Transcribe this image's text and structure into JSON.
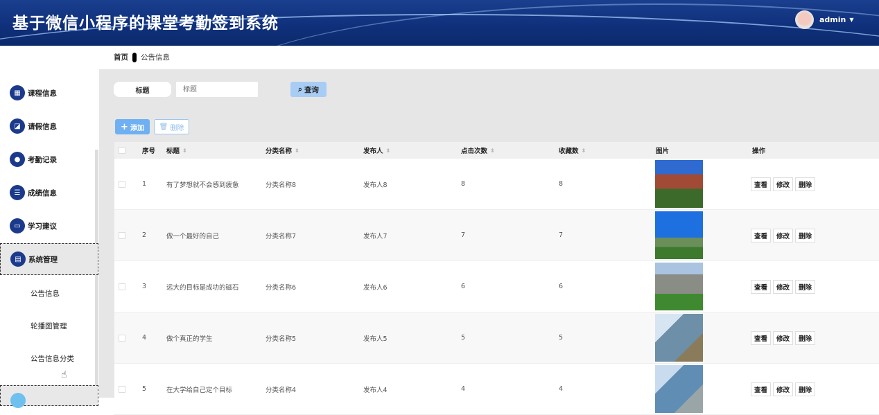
{
  "header": {
    "title": "基于微信小程序的课堂考勤签到系统",
    "user": "admin"
  },
  "sidebar": {
    "items": [
      {
        "label": "课程信息",
        "icon": "grid-icon",
        "glyph": "▦"
      },
      {
        "label": "请假信息",
        "icon": "chart-icon",
        "glyph": "◪"
      },
      {
        "label": "考勤记录",
        "icon": "user-icon",
        "glyph": "●"
      },
      {
        "label": "成绩信息",
        "icon": "sliders-icon",
        "glyph": "☰"
      },
      {
        "label": "学习建议",
        "icon": "chat-icon",
        "glyph": "▭"
      },
      {
        "label": "系统管理",
        "icon": "clipboard-icon",
        "glyph": "▤"
      }
    ],
    "subitems": [
      "公告信息",
      "轮播图管理",
      "公告信息分类"
    ]
  },
  "breadcrumb": {
    "home": "首页",
    "current": "公告信息"
  },
  "search": {
    "label": "标题",
    "placeholder": "标题",
    "query": "查询"
  },
  "actions": {
    "add": "添加",
    "delete": "删除"
  },
  "table": {
    "columns": [
      "序号",
      "标题",
      "分类名称",
      "发布人",
      "点击次数",
      "收藏数",
      "图片",
      "操作"
    ],
    "rows": [
      {
        "no": "1",
        "title": "有了梦想就不会感到疲惫",
        "cat": "分类名称8",
        "pub": "发布人8",
        "clicks": "8",
        "favs": "8"
      },
      {
        "no": "2",
        "title": "做一个最好的自己",
        "cat": "分类名称7",
        "pub": "发布人7",
        "clicks": "7",
        "favs": "7"
      },
      {
        "no": "3",
        "title": "远大的目标是成功的磁石",
        "cat": "分类名称6",
        "pub": "发布人6",
        "clicks": "6",
        "favs": "6"
      },
      {
        "no": "4",
        "title": "做个真正的学生",
        "cat": "分类名称5",
        "pub": "发布人5",
        "clicks": "5",
        "favs": "5"
      },
      {
        "no": "5",
        "title": "在大学给自己定个目标",
        "cat": "分类名称4",
        "pub": "发布人4",
        "clicks": "4",
        "favs": "4"
      }
    ],
    "ops": [
      "查看",
      "修改",
      "删除"
    ]
  }
}
